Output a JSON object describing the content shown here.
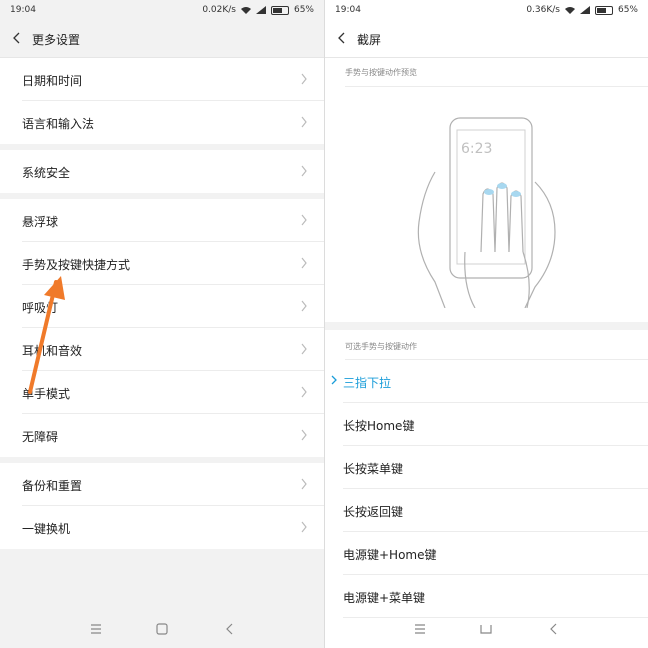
{
  "left": {
    "status": {
      "time": "19:04",
      "speed": "0.02K/s",
      "battery": "65%"
    },
    "title": "更多设置",
    "groups": [
      {
        "items": [
          {
            "label": "日期和时间"
          },
          {
            "label": "语言和输入法"
          }
        ]
      },
      {
        "items": [
          {
            "label": "系统安全"
          }
        ]
      },
      {
        "items": [
          {
            "label": "悬浮球"
          },
          {
            "label": "手势及按键快捷方式"
          },
          {
            "label": "呼吸灯"
          },
          {
            "label": "耳机和音效"
          },
          {
            "label": "单手模式"
          },
          {
            "label": "无障碍"
          }
        ]
      },
      {
        "items": [
          {
            "label": "备份和重置"
          },
          {
            "label": "一键换机"
          }
        ]
      }
    ]
  },
  "right": {
    "status": {
      "time": "19:04",
      "speed": "0.36K/s",
      "battery": "65%"
    },
    "title": "截屏",
    "preview_label": "手势与按键动作预览",
    "preview_phone_time": "6:23",
    "options_label": "可选手势与按键动作",
    "options": [
      {
        "label": "三指下拉",
        "selected": true
      },
      {
        "label": "长按Home键",
        "selected": false
      },
      {
        "label": "长按菜单键",
        "selected": false
      },
      {
        "label": "长按返回键",
        "selected": false
      },
      {
        "label": "电源键+Home键",
        "selected": false
      },
      {
        "label": "电源键+菜单键",
        "selected": false
      }
    ]
  },
  "colors": {
    "accent": "#1a9dd9",
    "annotation_arrow": "#f07a2a",
    "background": "#f2f2f2"
  },
  "icons": {
    "back": "chevron-left-icon",
    "row": "chevron-right-icon",
    "selected": "check-icon",
    "nav": [
      "menu-icon",
      "home-icon",
      "back-icon"
    ],
    "status": [
      "wifi-icon",
      "signal-icon",
      "battery-icon"
    ]
  }
}
